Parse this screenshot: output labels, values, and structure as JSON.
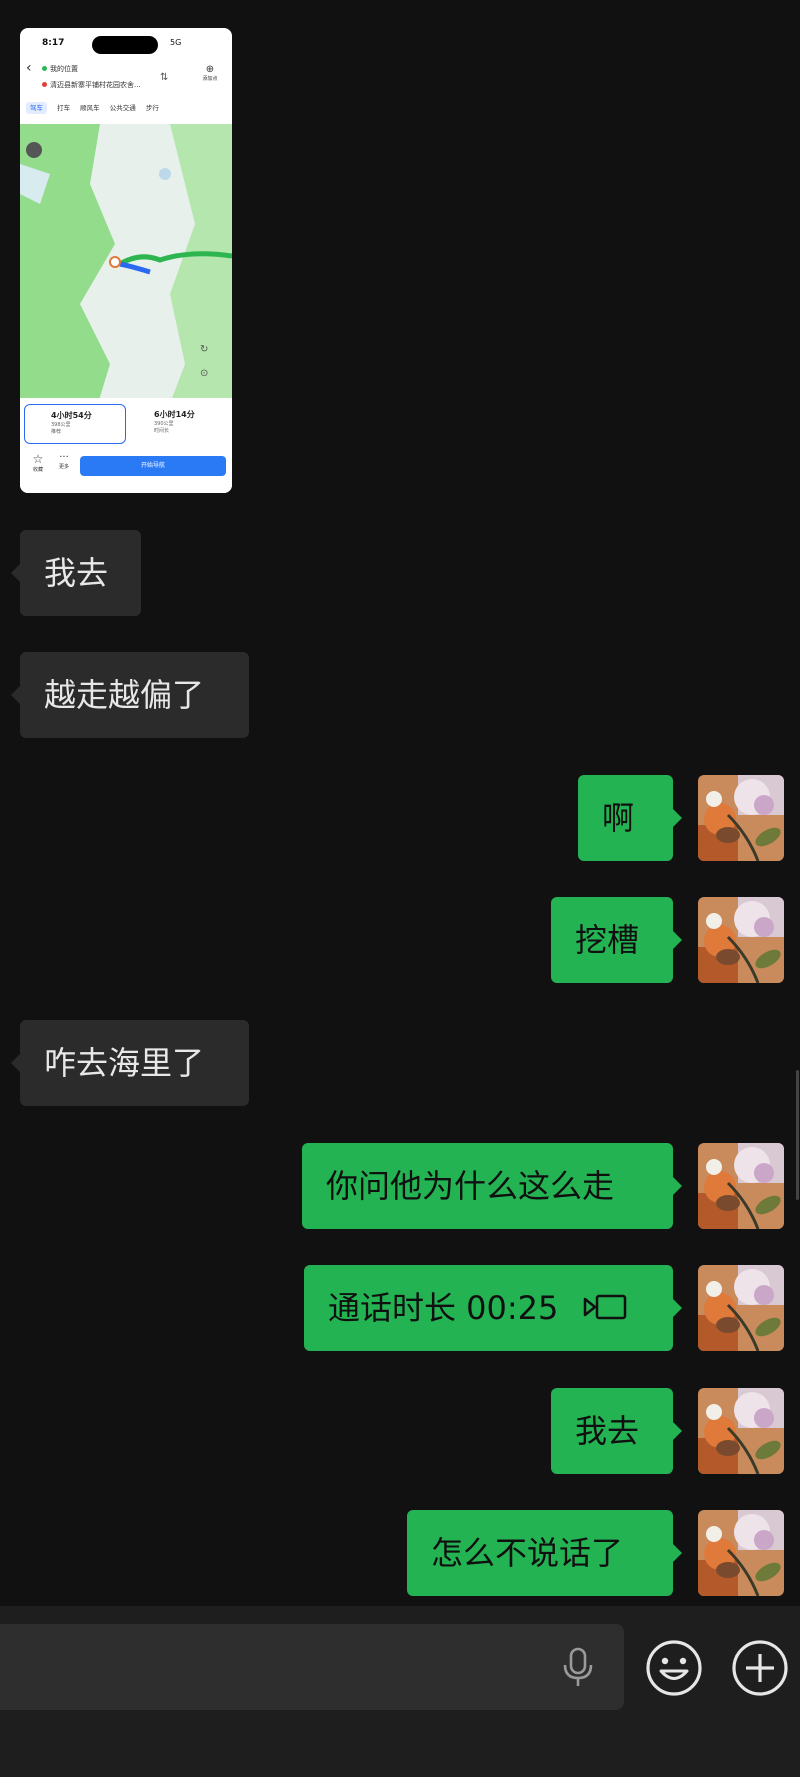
{
  "thumbnail": {
    "status_time": "8:17",
    "status_signal": "5G",
    "from_label": "我的位置",
    "to_label": "清迈县新寨平铺村花园农舍...",
    "add_label": "添加点",
    "modes": [
      "驾车",
      "打车",
      "顺风车",
      "公共交通",
      "步行"
    ],
    "route1_time": "4小时54分",
    "route1_dist": "398公里",
    "route1_tag": "推荐",
    "route2_time": "6小时14分",
    "route2_dist": "390公里",
    "route2_tag": "时间长",
    "fav_label": "收藏",
    "more_label": "更多",
    "go_label": "开始导航",
    "colors": {
      "route_green": "#2db550",
      "route_blue": "#2a6af0",
      "map_green": "#8fd98a"
    }
  },
  "messages": [
    {
      "side": "received",
      "text": "我去"
    },
    {
      "side": "received",
      "text": "越走越偏了"
    },
    {
      "side": "sent",
      "text": "啊"
    },
    {
      "side": "sent",
      "text": "挖槽"
    },
    {
      "side": "received",
      "text": "咋去海里了"
    },
    {
      "side": "sent",
      "text": "你问他为什么这么走"
    },
    {
      "side": "sent",
      "text": "通话时长 00:25",
      "icon": "video-call-icon"
    },
    {
      "side": "sent",
      "text": "我去"
    },
    {
      "side": "sent",
      "text": "怎么不说话了"
    }
  ],
  "input_bar": {
    "value": "",
    "icons": [
      "microphone-icon",
      "emoji-icon",
      "plus-icon"
    ]
  },
  "colors": {
    "background": "#111111",
    "received_bubble": "#2b2b2b",
    "sent_bubble": "#24b353",
    "bottom_bar": "#1e1e1e"
  }
}
